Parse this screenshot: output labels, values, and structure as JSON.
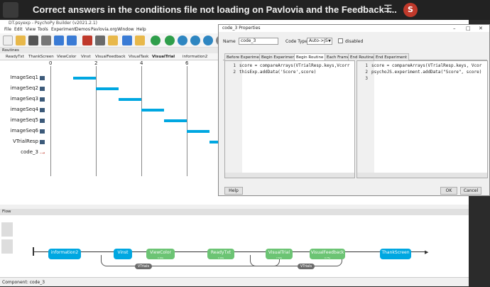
{
  "forum": {
    "title": "Correct answers in the conditions file not loading on Pavlovia and the Feedback i...",
    "avatar_letter": "S"
  },
  "builder": {
    "window_title": "DT.psyexp - PsychoPy Builder (v2021.2.1)",
    "menus": [
      "File",
      "Edit",
      "View",
      "Tools",
      "Experiment",
      "Demos",
      "Pavlovia.org",
      "Window",
      "Help"
    ],
    "routines_header": "Routines",
    "routine_tabs": [
      "ReadyTxt",
      "ThankScreen",
      "ViewColor",
      "Vinst",
      "VisualFeedback",
      "VisualTask",
      "VisualTrial",
      "information2"
    ],
    "active_tab": "VisualTrial",
    "timeline_ticks": [
      "0",
      "2",
      "4",
      "6"
    ],
    "components": [
      "ImageSeq1",
      "imageSeq2",
      "imageSeq3",
      "imageSeq4",
      "imageSeq5",
      "imageSeq6",
      "VTrialResp",
      "code_3"
    ],
    "component_bars": [
      {
        "start": 1.0,
        "end": 2.0
      },
      {
        "start": 2.0,
        "end": 3.0
      },
      {
        "start": 3.0,
        "end": 4.0
      },
      {
        "start": 4.0,
        "end": 5.0
      },
      {
        "start": 5.0,
        "end": 6.0
      },
      {
        "start": 6.0,
        "end": 7.0
      },
      {
        "start": 7.0,
        "end": 7.4
      }
    ],
    "flow_header": "Flow",
    "flow_routines": [
      "information2",
      "Vinst",
      "ViewColor",
      "ReadyTxt",
      "VisualTrial",
      "VisualFeedback",
      "ThankScreen"
    ],
    "flow_sublabels": {
      "ViewColor": "0.90s",
      "ReadyTxt": "0.90s",
      "VisualTrial": "7.50s",
      "VisualFeedback": "0.75s"
    },
    "loops": [
      "VTrials",
      "VTrials"
    ],
    "status": "Component: code_3",
    "colors": {
      "routine_blue": "#00a7e1",
      "routine_green": "#6cc474",
      "timeline_bar": "#00a7e1"
    }
  },
  "dialog": {
    "title": "code_3 Properties",
    "name_label": "Name",
    "name_value": "code_3",
    "code_type_label": "Code Type",
    "code_type_value": "Auto->JS",
    "disabled_label": "disabled",
    "tabs": [
      "Before Experiment",
      "Begin Experiment",
      "Begin Routine *",
      "Each Frame",
      "End Routine",
      "End Experiment"
    ],
    "active_tab": "Begin Routine *",
    "py_code": [
      "score = compareArrays(VTrialResp.keys,Vcorr",
      "thisExp.addData('Score',score)"
    ],
    "js_code": [
      "score = compareArrays(VTrialResp.keys, Vcor",
      "psychoJS.experiment.addData(\"Score\", score)",
      ""
    ],
    "help_button": "Help",
    "ok_button": "OK",
    "cancel_button": "Cancel"
  }
}
